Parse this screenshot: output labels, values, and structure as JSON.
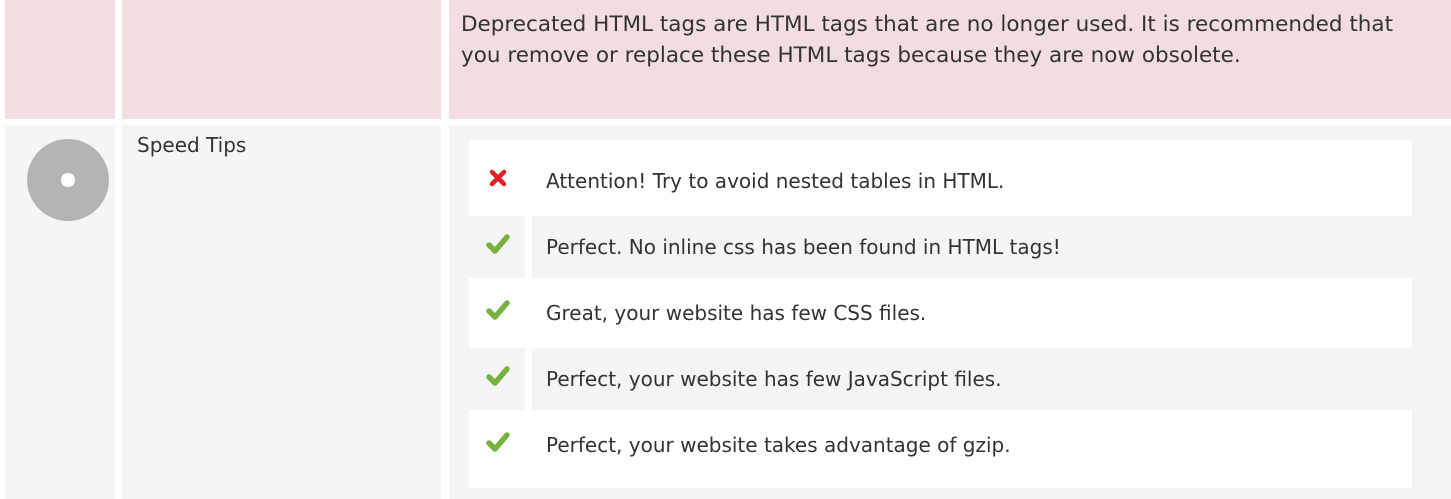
{
  "deprecated_tags": {
    "description": "Deprecated HTML tags are HTML tags that are no longer used. It is recommended that you remove or replace these HTML tags because they are now obsolete."
  },
  "speed_tips": {
    "title": "Speed Tips",
    "status_icon": "neutral-circle-icon",
    "colors": {
      "error": "#e32020",
      "success": "#78b13f",
      "warning_bg": "#f2dede",
      "neutral_circle": "#b4b4b4"
    },
    "tips": [
      {
        "status": "error",
        "icon": "cross-icon",
        "text": "Attention! Try to avoid nested tables in HTML."
      },
      {
        "status": "success",
        "icon": "check-icon",
        "text": "Perfect. No inline css has been found in HTML tags!"
      },
      {
        "status": "success",
        "icon": "check-icon",
        "text": "Great, your website has few CSS files."
      },
      {
        "status": "success",
        "icon": "check-icon",
        "text": "Perfect, your website has few JavaScript files."
      },
      {
        "status": "success",
        "icon": "check-icon",
        "text": "Perfect, your website takes advantage of gzip."
      }
    ]
  }
}
